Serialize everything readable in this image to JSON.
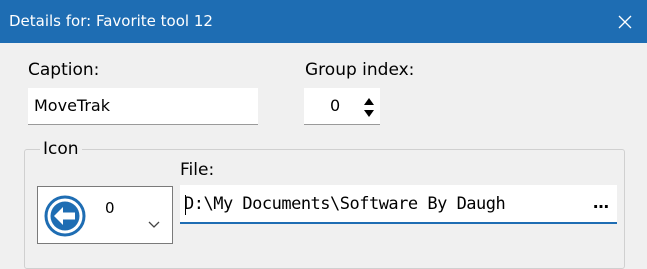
{
  "window": {
    "title": "Details for: Favorite tool 12",
    "titlebar_color": "#1e6db3",
    "close_icon": "close-icon"
  },
  "caption": {
    "label": "Caption:",
    "value": "MoveTrak"
  },
  "group_index": {
    "label": "Group index:",
    "value": "0"
  },
  "icon_group": {
    "legend": "Icon",
    "combo_value": "0",
    "combo_icon": "back-arrow-circle-icon"
  },
  "file": {
    "label": "File:",
    "value": "D:\\My Documents\\Software By Daugh",
    "browse_label": "…"
  }
}
